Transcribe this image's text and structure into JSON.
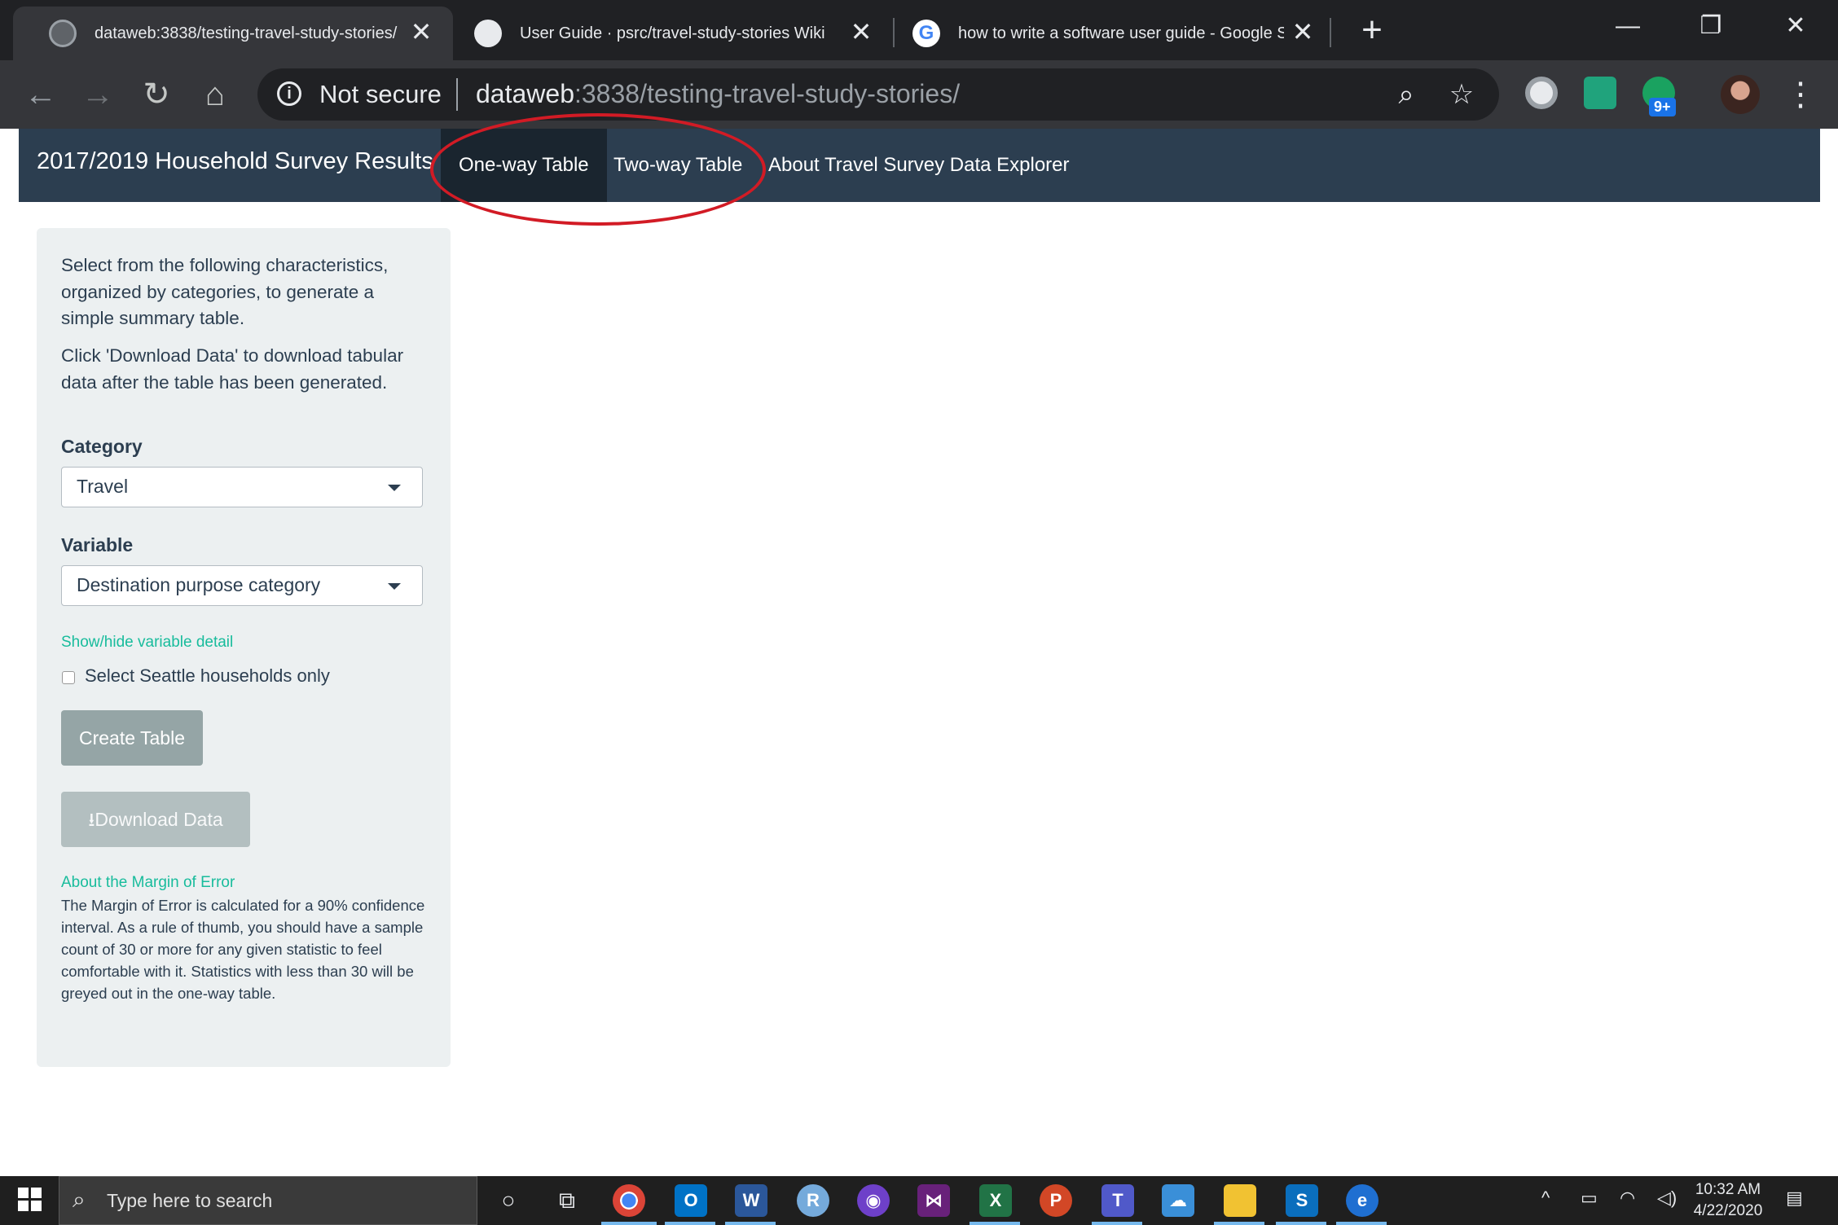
{
  "browser": {
    "tabs": [
      {
        "title": "dataweb:3838/testing-travel-study-stories/",
        "active": true
      },
      {
        "title": "User Guide · psrc/travel-study-stories Wiki",
        "active": false
      },
      {
        "title": "how to write a software user guide - Google Search",
        "active": false
      }
    ],
    "security_label": "Not secure",
    "url_host": "dataweb",
    "url_rest": ":3838/testing-travel-study-stories/",
    "extension_badge": "9+"
  },
  "app": {
    "brand": "2017/2019 Household Survey Results",
    "nav_tabs": [
      {
        "label": "One-way Table",
        "active": true
      },
      {
        "label": "Two-way Table",
        "active": false
      },
      {
        "label": "About Travel Survey Data Explorer",
        "active": false
      }
    ],
    "colors": {
      "navbar": "#2c3e50",
      "accent": "#18bc9c",
      "highlight": "#d21b25"
    }
  },
  "sidebar": {
    "intro": "Select from the following characteristics, organized by categories, to generate a simple summary table.",
    "download_hint": "Click 'Download Data' to download tabular data after the table has been generated.",
    "category_label": "Category",
    "category_value": "Travel",
    "variable_label": "Variable",
    "variable_value": "Destination purpose category",
    "toggle_detail_link": "Show/hide variable detail",
    "seattle_checkbox_label": "Select Seattle households only",
    "seattle_checked": false,
    "create_button": "Create Table",
    "download_button": "Download Data",
    "moe_title": "About the Margin of Error",
    "moe_text": "The Margin of Error is calculated for a 90% confidence interval. As a rule of thumb, you should have a sample count of 30 or more for any given statistic to feel comfortable with it. Statistics with less than 30 will be greyed out in the one-way table."
  },
  "taskbar": {
    "search_placeholder": "Type here to search",
    "time": "10:32 AM",
    "date": "4/22/2020"
  }
}
